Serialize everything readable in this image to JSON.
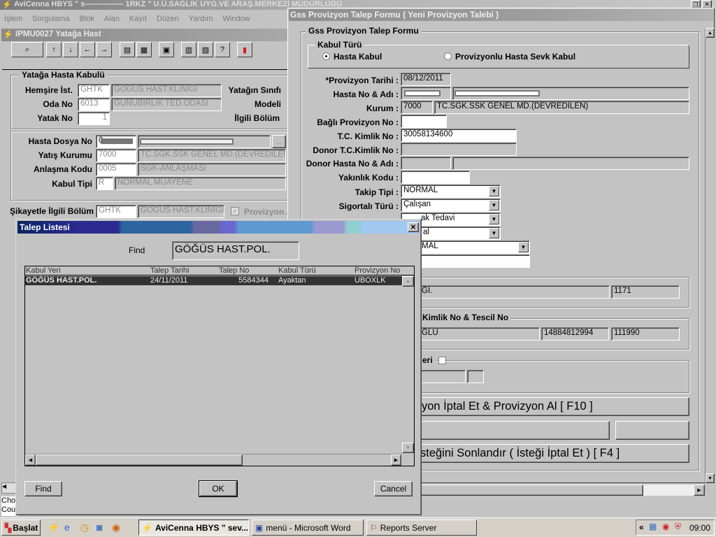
{
  "main_window": {
    "title": "AviCenna HBYS \" s————— 1RKZ \" U.Ü.SAĞLIK UYG.VE ARAŞ.MERKEZİ MÜDÜRLÜĞÜ",
    "menu": [
      "İşlem",
      "Sorgulama",
      "Blok",
      "Alan",
      "Kayıt",
      "Düzen",
      "Yardım",
      "Window"
    ]
  },
  "child_window": {
    "title": "IPMU0027 Yatağa Hast",
    "group_title": "Yatağa Hasta Kabulü",
    "hemsire_label": "Hemşire İst.",
    "hemsire_code": "GHTK",
    "hemsire_name": "GÖĞÜS HAST.KLİNİĞİ",
    "oda_label": "Oda No",
    "oda_code": "6013",
    "oda_name": "GÜNÜBİRLİK TED.ODASI",
    "yatak_label": "Yatak No",
    "yatak_value": "1",
    "yatak_sinifi_label": "Yatağın Sınıfı",
    "modeli_label": "Modeli",
    "ilgili_bolum_label": "İlgili Bölüm",
    "dosya_label": "Hasta Dosya No",
    "dosya_value": "0",
    "kurum_label": "Yatış Kurumu",
    "kurum_code": "7000",
    "kurum_name": "TC.SGK.SSK GENEL MD.(DEVREDİLEN)",
    "anlasma_label": "Anlaşma Kodu",
    "anlasma_code": "0005",
    "anlasma_name": "SGK-ANLAŞMASI",
    "kabul_label": "Kabul Tipi",
    "kabul_code": "R",
    "kabul_name": "NORMAL MUAYENE",
    "sikayet_label": "Şikayetle İlgili Bölüm",
    "sikayet_code": "GHTK",
    "sikayet_name": "GÖĞÜS HAST.KLİNİĞİ.",
    "provizyon_check_label": "Provizyon A",
    "lookup_button": "...",
    "status_lines": [
      "Cho",
      "Cou"
    ]
  },
  "gss_form": {
    "title": "Gss Provizyon Talep Formu ( Yeni Provizyon Talebi )",
    "group_title": "Gss Provizyon Talep Formu",
    "kabul_turu_title": "Kabul Türü",
    "radio_hasta_kabul": "Hasta Kabul",
    "radio_sevk": "Provizyonlu Hasta Sevk Kabul",
    "radio_selected": "Hasta Kabul",
    "provizyon_tarihi_label": "*Provizyon Tarihi :",
    "provizyon_tarihi": "08/12/2011",
    "hasta_no_label": "Hasta No & Adı :",
    "kurum_label": "Kurum :",
    "kurum_code": "7000",
    "kurum_name": "TC.SGK.SSK GENEL MD.(DEVREDİLEN)",
    "bagli_label": "Bağlı Provizyon No :",
    "bagli_value": "",
    "tc_label": "T.C. Kimlik No :",
    "tc_value": "30058134600",
    "donor_tc_label": "Donor T.C.Kimlik No :",
    "donor_hasta_label": "Donor Hasta No & Adı :",
    "yakinlik_label": "Yakınlık Kodu :",
    "takip_label": "Takip Tipi :",
    "takip_value": "NORMAL",
    "sigortali_label": "Sigortalı Türü :",
    "sigortali_value": "Çalışan",
    "tedavi_partial": "ak Tedavi",
    "combo4_partial": "al",
    "combo5_partial": "MAL",
    "bolum_partial": "ĞI.",
    "bolum_code": "1171",
    "doktor_group_partial": "Kimlik No & Tescil No",
    "doktor_name_partial": "ĞLU",
    "doktor_tc": "14884812994",
    "doktor_tescil": "111990",
    "group3_partial": "eri",
    "btn_f10": "yon İptal Et & Provizyon Al [ F10 ]",
    "btn_f4": "steğini Sonlandır ( İsteği İptal Et ) [ F4 ]"
  },
  "dialog": {
    "title": "Talep Listesi",
    "find_label": "Find",
    "find_value": "GÖĞÜS HAST.POL.",
    "columns": [
      "Kabul Yeri",
      "Talep Tarihi",
      "Talep No",
      "Kabul Türü",
      "Provizyon No"
    ],
    "rows": [
      [
        "GÖĞÜS HAST.POL.",
        "24/11/2011",
        "5584344",
        "Ayaktan",
        "UBOXLK"
      ]
    ],
    "find_button": "Find",
    "ok_button": "OK",
    "cancel_button": "Cancel"
  },
  "taskbar": {
    "start": "Başlat",
    "tasks": [
      "AviCenna HBYS \" sev...",
      "menü - Microsoft Word",
      "Reports Server"
    ],
    "tray_expand": "«",
    "clock": "09:00"
  }
}
